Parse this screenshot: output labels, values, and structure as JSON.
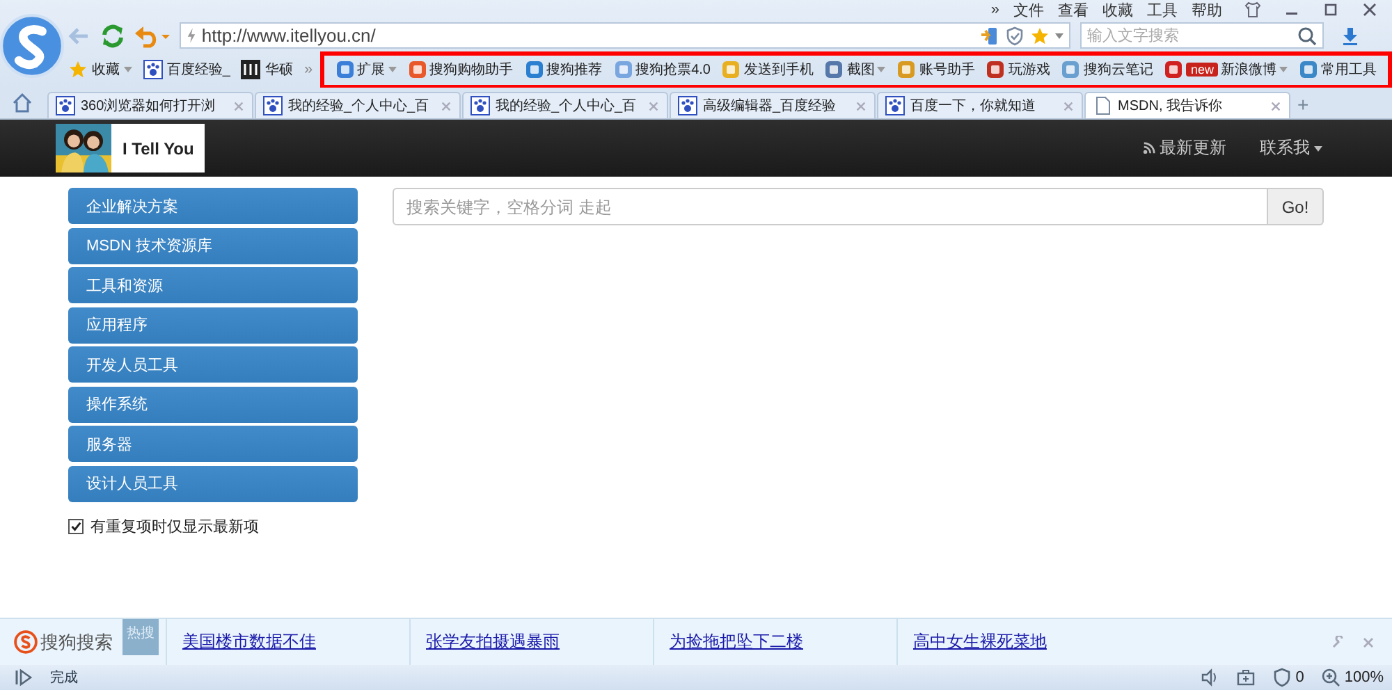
{
  "menu_bar": {
    "overflow": "»",
    "items": [
      "文件",
      "查看",
      "收藏",
      "工具",
      "帮助"
    ]
  },
  "address_bar": {
    "url": "http://www.itellyou.cn/"
  },
  "search_box": {
    "placeholder": "输入文字搜索"
  },
  "bookmarks": [
    {
      "label": "收藏",
      "dropdown": true
    },
    {
      "label": "百度经验_",
      "dropdown": false
    },
    {
      "label": "华硕",
      "dropdown": false
    }
  ],
  "bookmarks_overflow": "»",
  "toolbar": {
    "highlighted": true,
    "items": [
      {
        "label": "扩展",
        "dropdown": true
      },
      {
        "label": "搜狗购物助手",
        "dropdown": false
      },
      {
        "label": "搜狗推荐",
        "dropdown": false
      },
      {
        "label": "搜狗抢票4.0",
        "dropdown": false
      },
      {
        "label": "发送到手机",
        "dropdown": false
      },
      {
        "label": "截图",
        "dropdown": true
      },
      {
        "label": "账号助手",
        "dropdown": false
      },
      {
        "label": "玩游戏",
        "dropdown": false
      },
      {
        "label": "搜狗云笔记",
        "dropdown": false
      },
      {
        "label": "新浪微博",
        "badge": "new",
        "dropdown": true
      },
      {
        "label": "常用工具",
        "dropdown": false
      }
    ]
  },
  "tabs": [
    {
      "label": "360浏览器如何打开浏",
      "selected": false
    },
    {
      "label": "我的经验_个人中心_百",
      "selected": false
    },
    {
      "label": "我的经验_个人中心_百",
      "selected": false
    },
    {
      "label": "高级编辑器_百度经验",
      "selected": false
    },
    {
      "label": "百度一下，你就知道",
      "selected": false
    },
    {
      "label": "MSDN, 我告诉你",
      "selected": true
    }
  ],
  "new_tab": "+",
  "site": {
    "brand": "I Tell You",
    "nav": [
      {
        "label": "最新更新",
        "kind": "rss"
      },
      {
        "label": "联系我",
        "kind": "dropdown"
      }
    ],
    "sidebar": [
      "企业解决方案",
      "MSDN 技术资源库",
      "工具和资源",
      "应用程序",
      "开发人员工具",
      "操作系统",
      "服务器",
      "设计人员工具"
    ],
    "option": {
      "label": "有重复项时仅显示最新项",
      "checked": true
    },
    "search": {
      "placeholder": "搜索关键字，空格分词 走起",
      "button": "Go!"
    }
  },
  "hot_search": {
    "brand": "搜狗搜索",
    "badge": "热搜",
    "links": [
      "美国楼市数据不佳",
      "张学友拍摄遇暴雨",
      "为捡拖把坠下二楼",
      "高中女生裸死菜地"
    ]
  },
  "status_bar": {
    "text": "完成",
    "blocked": "0",
    "zoom": "100%"
  }
}
